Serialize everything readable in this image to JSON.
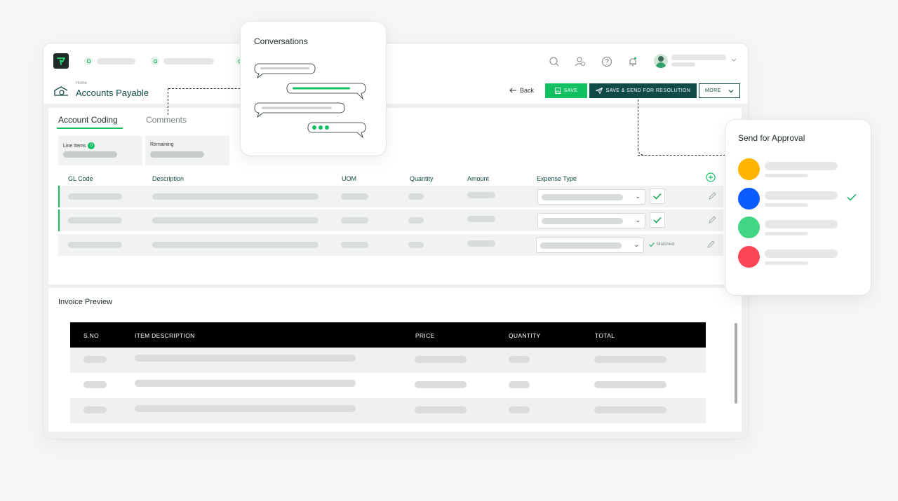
{
  "app": {
    "page": {
      "breadcrumb": "Home",
      "title": "Accounts Payable"
    },
    "actions": {
      "back_label": "Back",
      "save_label": "SAVE",
      "send_label": "SAVE & SEND FOR RESOLUTION",
      "more_label": "MORE"
    }
  },
  "coding": {
    "tabs": [
      {
        "label": "Account Coding",
        "active": true
      },
      {
        "label": "Comments",
        "active": false
      }
    ],
    "stats": [
      {
        "label": "Line Items",
        "badge": "0"
      },
      {
        "label": "Remaining"
      }
    ],
    "columns": [
      "GL Code",
      "Description",
      "UOM",
      "Quantity",
      "Amount",
      "Expense Type"
    ],
    "rows": [
      {
        "status": "checked"
      },
      {
        "status": "checked"
      },
      {
        "status": "matched",
        "status_label": "Matched"
      }
    ]
  },
  "invoice": {
    "title": "Invoice Preview",
    "columns": [
      "S.NO",
      "ITEM DESCRIPTION",
      "PRICE",
      "QUANTITY",
      "TOTAL"
    ],
    "row_count": 3
  },
  "conversations": {
    "title": "Conversations"
  },
  "approval": {
    "title": "Send for Approval",
    "approvers": [
      {
        "color": "#ffb400",
        "selected": false
      },
      {
        "color": "#0a5cff",
        "selected": true
      },
      {
        "color": "#41d585",
        "selected": false
      },
      {
        "color": "#fb4755",
        "selected": false
      }
    ]
  },
  "colors": {
    "accent_green": "#12c062",
    "brand_dark_teal": "#0e4a46"
  }
}
